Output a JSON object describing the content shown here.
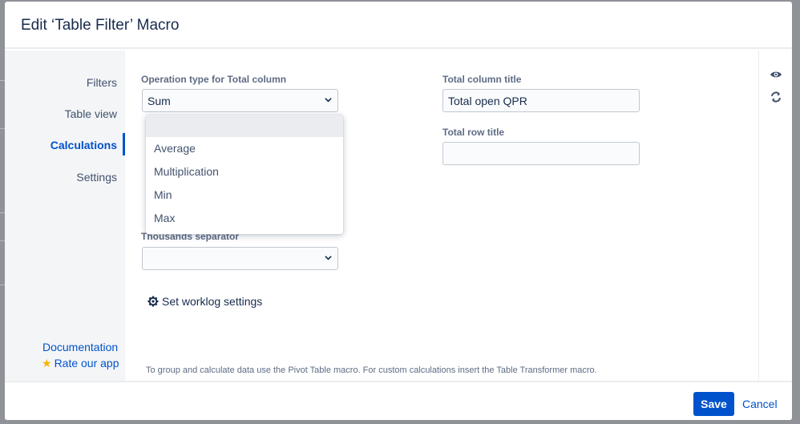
{
  "dialog": {
    "title": "Edit ‘Table Filter’ Macro"
  },
  "sidebar": {
    "items": [
      {
        "label": "Filters",
        "active": false
      },
      {
        "label": "Table view",
        "active": false
      },
      {
        "label": "Calculations",
        "active": true
      },
      {
        "label": "Settings",
        "active": false
      }
    ],
    "documentation_link": "Documentation",
    "rate_link": "Rate our app",
    "rate_icon": "star-icon"
  },
  "form": {
    "operation_label": "Operation type for Total column",
    "operation_value": "Sum",
    "operation_options": [
      "",
      "Average",
      "Multiplication",
      "Min",
      "Max"
    ],
    "thousands_label": "Thousands separator",
    "thousands_value": "",
    "total_column_label": "Total column title",
    "total_column_value": "Total open QPR",
    "total_row_label": "Total row title",
    "total_row_value": "",
    "worklog_link": "Set worklog settings",
    "hint": "To group and calculate data use the Pivot Table macro. For custom calculations insert the Table Transformer macro."
  },
  "rail": {
    "icons": [
      "eye-icon",
      "refresh-icon"
    ]
  },
  "footer": {
    "save_label": "Save",
    "cancel_label": "Cancel"
  },
  "colors": {
    "accent": "#0052cc",
    "overlay": "#8f9297",
    "sidebar_bg": "#f4f5f7"
  }
}
